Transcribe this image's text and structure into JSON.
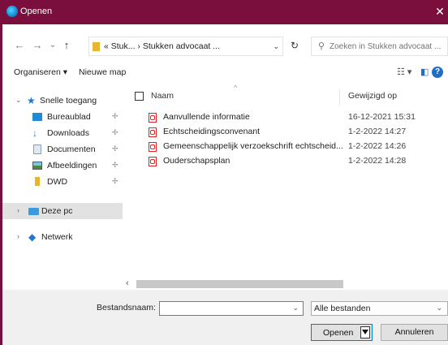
{
  "window": {
    "title": "Openen",
    "close_glyph": "✕"
  },
  "address": {
    "back_glyph": "←",
    "forward_glyph": "→",
    "recent_glyph": "⌄",
    "up_glyph": "↑",
    "breadcrumb": "«  Stuk...  ›  Stukken advocaat ...",
    "refresh_glyph": "↻",
    "search_placeholder": "Zoeken in Stukken advocaat ..."
  },
  "toolbar": {
    "organize": "Organiseren ▾",
    "new_folder": "Nieuwe map"
  },
  "sidebar": {
    "quick_access": "Snelle toegang",
    "items": [
      {
        "label": "Bureaublad",
        "icon": "desktop-icon"
      },
      {
        "label": "Downloads",
        "icon": "downloads-icon"
      },
      {
        "label": "Documenten",
        "icon": "documents-icon"
      },
      {
        "label": "Afbeeldingen",
        "icon": "pictures-icon"
      },
      {
        "label": "DWD",
        "icon": "folder-icon"
      }
    ],
    "this_pc": "Deze pc",
    "network": "Netwerk"
  },
  "list": {
    "col_name": "Naam",
    "col_date": "Gewijzigd op",
    "files": [
      {
        "name": "Aanvullende informatie",
        "date": "16-12-2021 15:31"
      },
      {
        "name": "Echtscheidingsconvenant",
        "date": "1-2-2022 14:27"
      },
      {
        "name": "Gemeenschappelijk verzoekschrift echtscheid...",
        "date": "1-2-2022 14:26"
      },
      {
        "name": "Ouderschapsplan",
        "date": "1-2-2022 14:28"
      }
    ]
  },
  "footer": {
    "filename_label": "Bestandsnaam:",
    "filename_value": "",
    "filetype": "Alle bestanden",
    "open": "Openen",
    "cancel": "Annuleren"
  },
  "colors": {
    "titlebar": "#7a0f3e",
    "pdf_red": "#d22222",
    "accent": "#0078d4"
  }
}
